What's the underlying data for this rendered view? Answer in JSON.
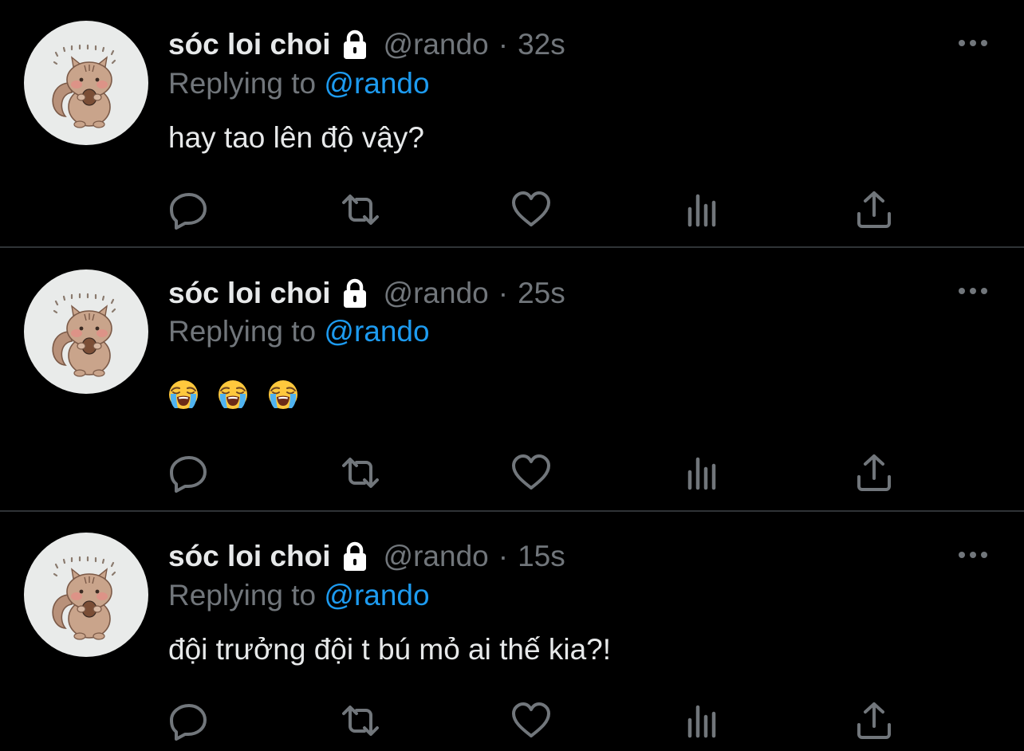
{
  "colors": {
    "background": "#000000",
    "primary_text": "#e7e9ea",
    "secondary_text": "#71767b",
    "link": "#1d9bf0",
    "divider": "#2f3336"
  },
  "tweets": [
    {
      "display_name": "sóc loi choi",
      "lock_icon": "lock-icon",
      "handle": "@rando",
      "separator": "·",
      "time": "32s",
      "replying_prefix": "Replying to",
      "replying_to": "@rando",
      "text": "hay tao lên độ vậy?",
      "actions": [
        "reply-icon",
        "retweet-icon",
        "like-icon",
        "views-icon",
        "share-icon"
      ]
    },
    {
      "display_name": "sóc loi choi",
      "lock_icon": "lock-icon",
      "handle": "@rando",
      "separator": "·",
      "time": "25s",
      "replying_prefix": "Replying to",
      "replying_to": "@rando",
      "emojis": [
        "loudly-crying-face-emoji",
        "loudly-crying-face-emoji",
        "loudly-crying-face-emoji"
      ],
      "actions": [
        "reply-icon",
        "retweet-icon",
        "like-icon",
        "views-icon",
        "share-icon"
      ]
    },
    {
      "display_name": "sóc loi choi",
      "lock_icon": "lock-icon",
      "handle": "@rando",
      "separator": "·",
      "time": "15s",
      "replying_prefix": "Replying to",
      "replying_to": "@rando",
      "text": "đội trưởng đội t bú mỏ ai thế kia?!",
      "actions": [
        "reply-icon",
        "retweet-icon",
        "like-icon",
        "views-icon",
        "share-icon"
      ]
    }
  ]
}
